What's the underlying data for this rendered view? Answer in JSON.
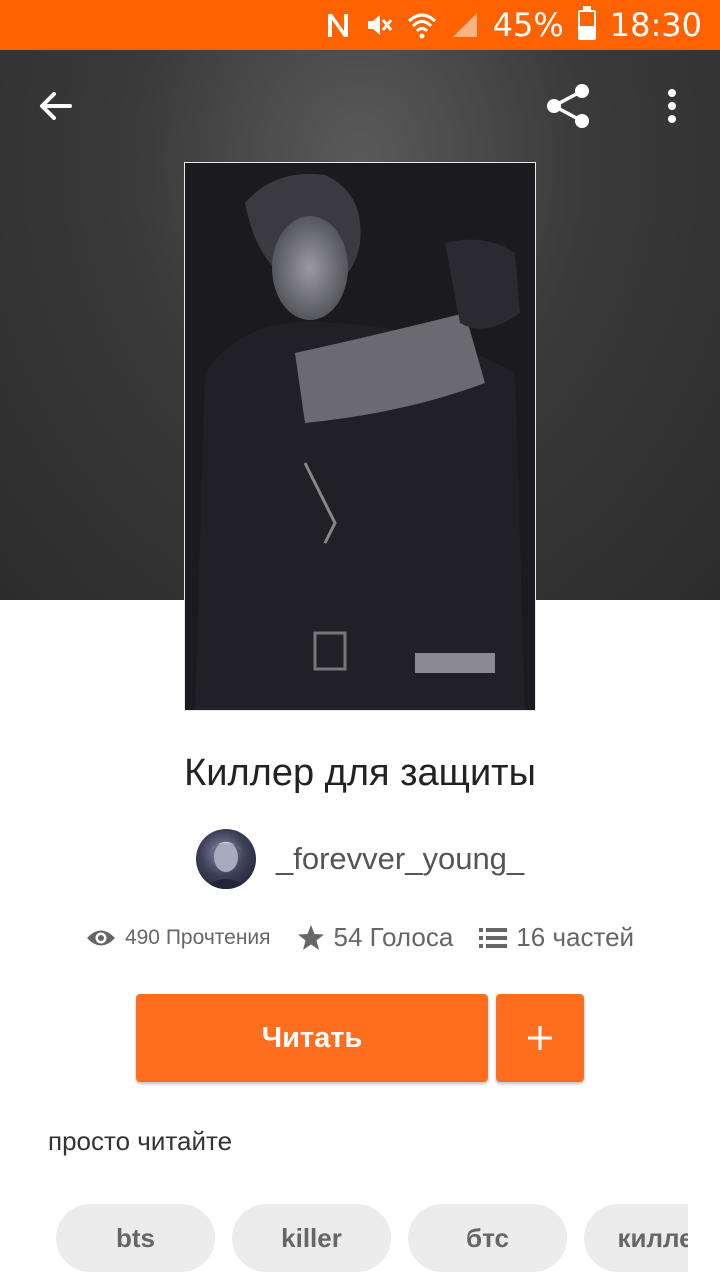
{
  "status_bar": {
    "battery": "45%",
    "time": "18:30",
    "battery_level": 0.45,
    "icons": [
      "nfc-icon",
      "mute-icon",
      "wifi-icon",
      "signal-icon",
      "battery-icon"
    ]
  },
  "toolbar": {
    "back_icon": "arrow-back-icon",
    "share_icon": "share-icon",
    "more_icon": "more-vert-icon"
  },
  "story": {
    "title": "Киллер для защиты",
    "author": "_forevver_young_",
    "reads": "490 Прочтения",
    "votes": "54 Голоса",
    "parts": "16 частей",
    "description": "просто читайте"
  },
  "actions": {
    "read_label": "Читать",
    "add_label": "+"
  },
  "tags": [
    "bts",
    "killer",
    "бтс",
    "киллер"
  ],
  "colors": {
    "accent": "#ff6200",
    "button": "#ff6d1f",
    "tag_bg": "#ececec"
  }
}
